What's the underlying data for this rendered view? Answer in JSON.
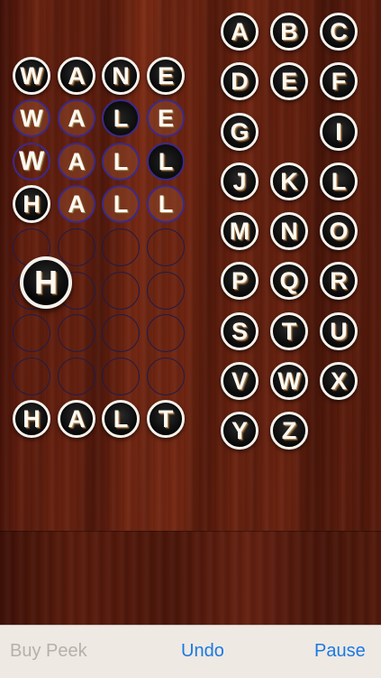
{
  "word_ladder": [
    {
      "letters": [
        "W",
        "A",
        "N",
        "E"
      ]
    },
    {
      "letters": [
        "W",
        "A",
        "L",
        "E"
      ]
    },
    {
      "letters": [
        "W",
        "A",
        "L",
        "L"
      ]
    },
    {
      "letters": [
        "H",
        "A",
        "L",
        "L"
      ]
    }
  ],
  "target_word": {
    "letters": [
      "H",
      "A",
      "L",
      "T"
    ]
  },
  "held_tile": "H",
  "keyboard": {
    "rows": [
      [
        "A",
        "B",
        "C"
      ],
      [
        "D",
        "E",
        "F"
      ],
      [
        "G",
        "",
        "I"
      ],
      [
        "J",
        "K",
        "L"
      ],
      [
        "M",
        "N",
        "O"
      ],
      [
        "P",
        "Q",
        "R"
      ],
      [
        "S",
        "T",
        "U"
      ],
      [
        "V",
        "W",
        "X"
      ],
      [
        "Y",
        "Z",
        ""
      ]
    ]
  },
  "toolbar": {
    "buy_peek": "Buy Peek",
    "undo": "Undo",
    "pause": "Pause",
    "link_color": "#1a7ae0",
    "disabled_color": "#b5b0ab"
  },
  "colors": {
    "wood": "#5e1d0d",
    "tile_border": "#f4f1ec",
    "slot_border": "#1f1c4a"
  }
}
